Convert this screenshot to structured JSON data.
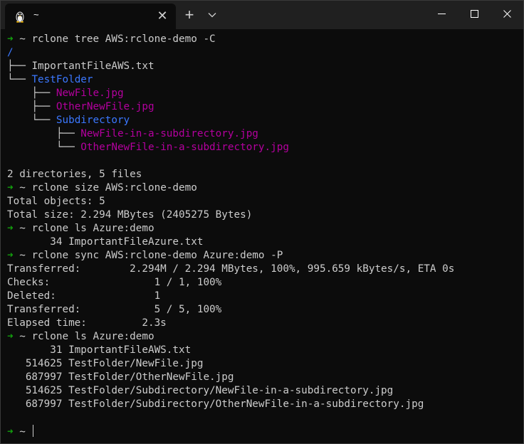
{
  "window": {
    "tab_title": "~",
    "tab_icon": "tux-icon",
    "close_tab_glyph": "✕",
    "new_tab_glyph": "+",
    "colors": {
      "background": "#0c0c0c",
      "titlebar": "#202020",
      "prompt_arrow": "#13a10e",
      "directory": "#3b78ff",
      "image_file": "#b4009e",
      "text": "#cccccc"
    }
  },
  "terminal": {
    "prompt_arrow": "➜",
    "prompt_dir": "~",
    "lines": [
      {
        "type": "prompt",
        "cmd": "rclone tree AWS:rclone-demo -C"
      },
      {
        "type": "tree",
        "prefix": "",
        "name": "/",
        "kind": "dir"
      },
      {
        "type": "tree",
        "prefix": "├── ",
        "name": "ImportantFileAWS.txt",
        "kind": "file"
      },
      {
        "type": "tree",
        "prefix": "└── ",
        "name": "TestFolder",
        "kind": "dir"
      },
      {
        "type": "tree",
        "prefix": "    ├── ",
        "name": "NewFile.jpg",
        "kind": "img"
      },
      {
        "type": "tree",
        "prefix": "    ├── ",
        "name": "OtherNewFile.jpg",
        "kind": "img"
      },
      {
        "type": "tree",
        "prefix": "    └── ",
        "name": "Subdirectory",
        "kind": "dir"
      },
      {
        "type": "tree",
        "prefix": "        ├── ",
        "name": "NewFile-in-a-subdirectory.jpg",
        "kind": "img"
      },
      {
        "type": "tree",
        "prefix": "        └── ",
        "name": "OtherNewFile-in-a-subdirectory.jpg",
        "kind": "img"
      },
      {
        "type": "text",
        "text": ""
      },
      {
        "type": "text",
        "text": "2 directories, 5 files"
      },
      {
        "type": "prompt",
        "cmd": "rclone size AWS:rclone-demo"
      },
      {
        "type": "text",
        "text": "Total objects: 5"
      },
      {
        "type": "text",
        "text": "Total size: 2.294 MBytes (2405275 Bytes)"
      },
      {
        "type": "prompt",
        "cmd": "rclone ls Azure:demo"
      },
      {
        "type": "text",
        "text": "       34 ImportantFileAzure.txt"
      },
      {
        "type": "prompt",
        "cmd": "rclone sync AWS:rclone-demo Azure:demo -P"
      },
      {
        "type": "text",
        "text": "Transferred:        2.294M / 2.294 MBytes, 100%, 995.659 kBytes/s, ETA 0s"
      },
      {
        "type": "text",
        "text": "Checks:                 1 / 1, 100%"
      },
      {
        "type": "text",
        "text": "Deleted:                1"
      },
      {
        "type": "text",
        "text": "Transferred:            5 / 5, 100%"
      },
      {
        "type": "text",
        "text": "Elapsed time:         2.3s"
      },
      {
        "type": "prompt",
        "cmd": "rclone ls Azure:demo"
      },
      {
        "type": "text",
        "text": "       31 ImportantFileAWS.txt"
      },
      {
        "type": "text",
        "text": "   514625 TestFolder/NewFile.jpg"
      },
      {
        "type": "text",
        "text": "   687997 TestFolder/OtherNewFile.jpg"
      },
      {
        "type": "text",
        "text": "   514625 TestFolder/Subdirectory/NewFile-in-a-subdirectory.jpg"
      },
      {
        "type": "text",
        "text": "   687997 TestFolder/Subdirectory/OtherNewFile-in-a-subdirectory.jpg"
      },
      {
        "type": "text",
        "text": ""
      },
      {
        "type": "cursor",
        "cmd": ""
      }
    ]
  }
}
